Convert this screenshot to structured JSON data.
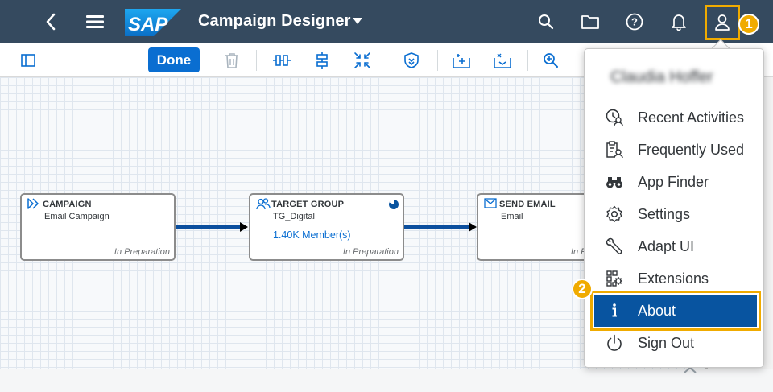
{
  "shell": {
    "title": "Campaign Designer",
    "logo_text": "SAP",
    "user_badge": "1"
  },
  "toolbar": {
    "done_label": "Done"
  },
  "canvas": {
    "nodes": [
      {
        "title": "CAMPAIGN",
        "subtitle": "Email Campaign",
        "status": "In Preparation"
      },
      {
        "title": "TARGET GROUP",
        "subtitle": "TG_Digital",
        "members": "1.40K Member(s)",
        "status": "In Preparation"
      },
      {
        "title": "SEND EMAIL",
        "subtitle": "Email",
        "status": "In Preparation"
      }
    ]
  },
  "menu": {
    "user_name": "Claudia Hoffer",
    "about_badge": "2",
    "items": [
      {
        "label": "Recent Activities",
        "icon": "recent-activities-icon"
      },
      {
        "label": "Frequently Used",
        "icon": "frequently-used-icon"
      },
      {
        "label": "App Finder",
        "icon": "binoculars-icon"
      },
      {
        "label": "Settings",
        "icon": "gear-icon"
      },
      {
        "label": "Adapt UI",
        "icon": "wrench-icon"
      },
      {
        "label": "Extensions",
        "icon": "extensions-icon"
      },
      {
        "label": "About",
        "icon": "info-icon"
      },
      {
        "label": "Sign Out",
        "icon": "power-icon"
      }
    ]
  },
  "colors": {
    "shell_bg": "#354a5f",
    "accent": "#0a6ed1",
    "highlight": "#f0ab00",
    "selected_bg": "#0854a0"
  }
}
